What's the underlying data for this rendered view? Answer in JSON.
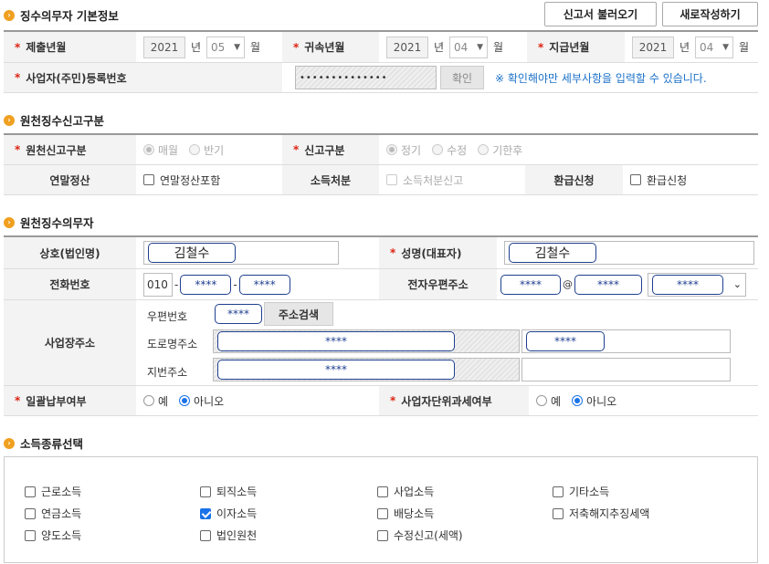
{
  "buttons": {
    "load_report": "신고서 불러오기",
    "new_write": "새로작성하기",
    "confirm": "확인",
    "address_search": "주소검색"
  },
  "sections": {
    "basic": "징수의무자 기본정보",
    "report_type": "원천징수신고구분",
    "withholder": "원천징수의무자",
    "income_type": "소득종류선택"
  },
  "basic": {
    "submit_label": "제출년월",
    "submit_year": "2021",
    "submit_month": "05",
    "attrib_label": "귀속년월",
    "attrib_year": "2021",
    "attrib_month": "04",
    "pay_label": "지급년월",
    "pay_year": "2021",
    "pay_month": "04",
    "year_unit": "년",
    "month_unit": "월",
    "bizno_label": "사업자(주민)등록번호",
    "bizno_value": "••••••••••••••",
    "notice": "※ 확인해야만 세부사항을 입력할 수 있습니다."
  },
  "report": {
    "kind_label": "원천신고구분",
    "monthly": "매월",
    "half": "반기",
    "type_label": "신고구분",
    "regular": "정기",
    "amend": "수정",
    "late": "기한후",
    "yearend_label": "연말정산",
    "yearend_option": "연말정산포함",
    "disposal_label": "소득처분",
    "disposal_option": "소득처분신고",
    "refund_label": "환급신청",
    "refund_option": "환급신청"
  },
  "withholder": {
    "company_label": "상호(법인명)",
    "company_value": "김철수",
    "rep_label": "성명(대표자)",
    "rep_value": "김철수",
    "phone_label": "전화번호",
    "phone1": "010",
    "phone2": "****",
    "phone3": "****",
    "email_label": "전자우편주소",
    "email_user": "****",
    "email_at": "@",
    "email_domain": "****",
    "email_select": "****",
    "address_label": "사업장주소",
    "zip_label": "우편번호",
    "zip_value": "****",
    "road_label": "도로명주소",
    "road_value": "****",
    "road_detail": "****",
    "lot_label": "지번주소",
    "lot_value": "****",
    "batch_label": "일괄납부여부",
    "yes": "예",
    "no": "아니오",
    "unit_label": "사업자단위과세여부"
  },
  "income": {
    "r1": [
      "근로소득",
      "퇴직소득",
      "사업소득",
      "기타소득"
    ],
    "r2": [
      "연금소득",
      "이자소득",
      "배당소득",
      "저축해지추징세액"
    ],
    "r3": [
      "양도소득",
      "법인원천",
      "수정신고(세액)"
    ]
  }
}
